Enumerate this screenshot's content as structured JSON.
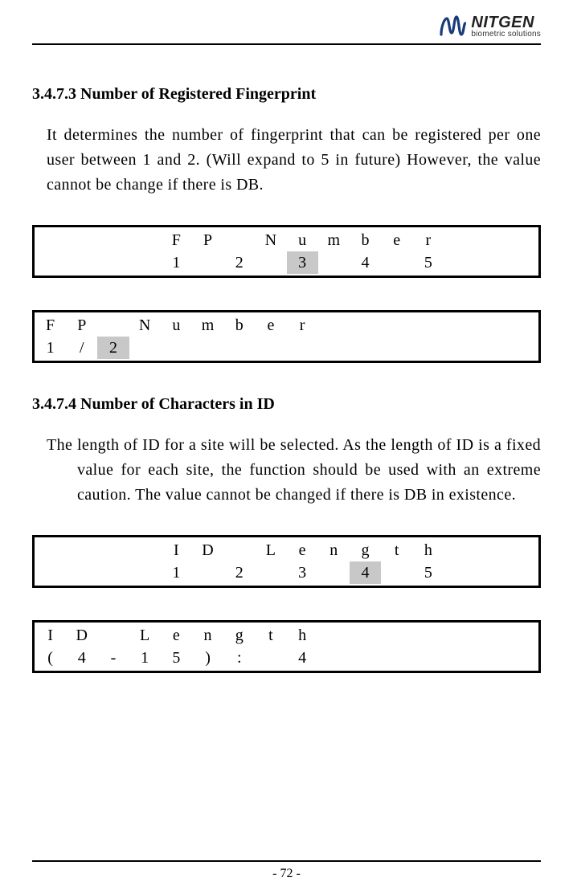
{
  "logo": {
    "main": "NITGEN",
    "sub": "biometric solutions"
  },
  "section1": {
    "heading": "3.4.7.3 Number of Registered Fingerprint",
    "body": "It determines the number of fingerprint that can be registered per one user between 1 and 2. (Will expand to 5 in future) However, the value cannot be change if there is DB."
  },
  "lcd1": {
    "row1": [
      "",
      "",
      "",
      "",
      "F",
      "P",
      "",
      "N",
      "u",
      "m",
      "b",
      "e",
      "r",
      "",
      "",
      ""
    ],
    "row2": [
      "",
      "",
      "",
      "",
      "1",
      "",
      "2",
      "",
      "3",
      "",
      "4",
      "",
      "5",
      "",
      "",
      ""
    ],
    "hl2": [
      8
    ]
  },
  "lcd2": {
    "row1": [
      "F",
      "P",
      "",
      "N",
      "u",
      "m",
      "b",
      "e",
      "r",
      "",
      "",
      "",
      "",
      "",
      "",
      ""
    ],
    "row2": [
      "1",
      "/",
      "2",
      "",
      "",
      "",
      "",
      "",
      "",
      "",
      "",
      "",
      "",
      "",
      "",
      ""
    ],
    "hl2": [
      2
    ]
  },
  "section2": {
    "heading": "3.4.7.4  Number of Characters in ID",
    "body": "The length of ID for a site will be selected. As the length of ID is a fixed value for each site, the function should be used with an extreme caution. The value cannot be changed if there is DB in existence."
  },
  "lcd3": {
    "row1": [
      "",
      "",
      "",
      "",
      "I",
      "D",
      "",
      "L",
      "e",
      "n",
      "g",
      "t",
      "h",
      "",
      "",
      ""
    ],
    "row2": [
      "",
      "",
      "",
      "",
      "1",
      "",
      "2",
      "",
      "3",
      "",
      "4",
      "",
      "5",
      "",
      "",
      ""
    ],
    "hl2": [
      10
    ]
  },
  "lcd4": {
    "row1": [
      "I",
      "D",
      "",
      "L",
      "e",
      "n",
      "g",
      "t",
      "h",
      "",
      "",
      "",
      "",
      "",
      "",
      ""
    ],
    "row2": [
      "(",
      "4",
      "-",
      "1",
      "5",
      ")",
      ":",
      "",
      "4",
      "",
      "",
      "",
      "",
      "",
      "",
      ""
    ],
    "hl2": []
  },
  "footer": "- 72 -"
}
